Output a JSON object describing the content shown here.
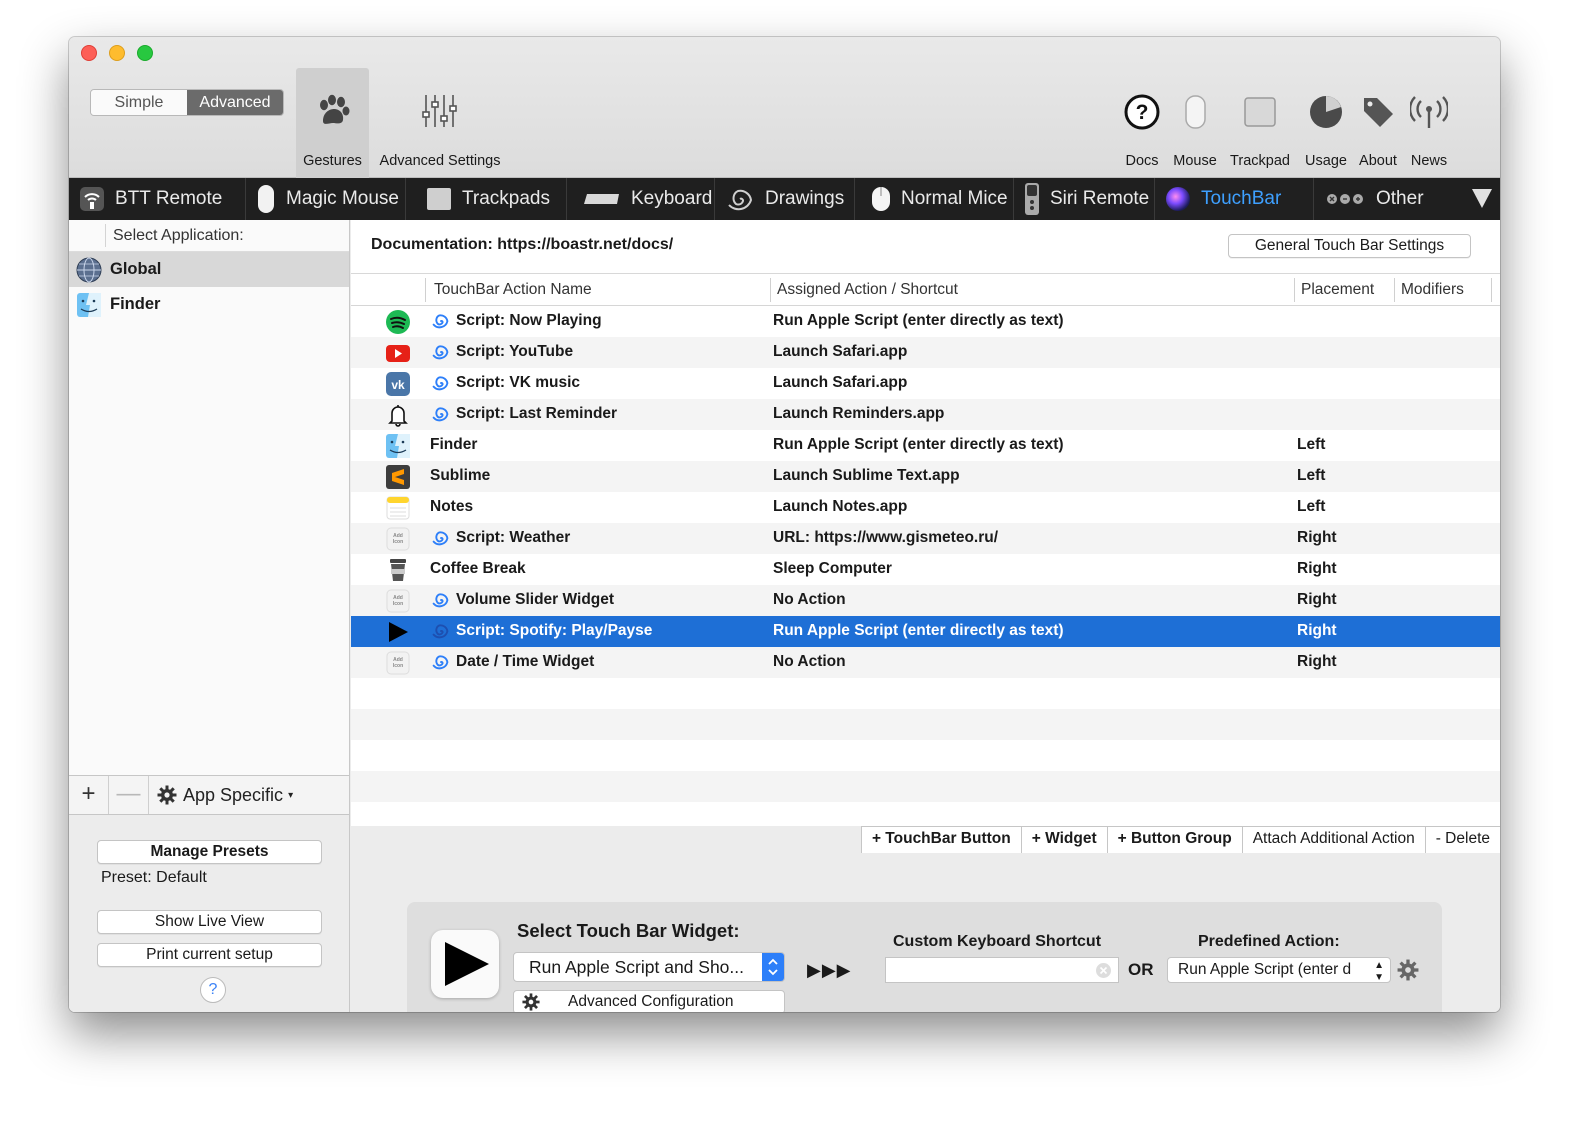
{
  "toolbar": {
    "mode_simple": "Simple",
    "mode_advanced": "Advanced",
    "gestures_label": "Gestures",
    "advanced_settings_label": "Advanced Settings",
    "right_tools": [
      "Docs",
      "Mouse",
      "Trackpad",
      "Usage",
      "About",
      "News"
    ]
  },
  "tabs": [
    "BTT Remote",
    "Magic Mouse",
    "Trackpads",
    "Keyboard",
    "Drawings",
    "Normal Mice",
    "Siri Remote",
    "TouchBar",
    "Other"
  ],
  "active_tab": "TouchBar",
  "sidebar": {
    "header": "Select Application:",
    "apps": [
      "Global",
      "Finder"
    ],
    "selected_app": "Global",
    "add": "+",
    "remove": "—",
    "app_specific": "App Specific",
    "manage_presets": "Manage Presets",
    "preset": "Preset: Default",
    "show_live_view": "Show Live View",
    "print_setup": "Print current setup",
    "help": "?"
  },
  "main": {
    "documentation": "Documentation: https://boastr.net/docs/",
    "general_settings": "General Touch Bar Settings",
    "columns": [
      "TouchBar Action Name",
      "Assigned Action / Shortcut",
      "Placement",
      "Modifiers"
    ],
    "rows": [
      {
        "icon": "spotify-icon",
        "script": true,
        "name": "Script: Now Playing",
        "action": "Run Apple Script (enter directly as text)",
        "placement": ""
      },
      {
        "icon": "youtube-icon",
        "script": true,
        "name": "Script: YouTube",
        "action": "Launch Safari.app",
        "placement": ""
      },
      {
        "icon": "vk-icon",
        "script": true,
        "name": "Script: VK music",
        "action": "Launch Safari.app",
        "placement": ""
      },
      {
        "icon": "bell-icon",
        "script": true,
        "name": "Script: Last Reminder",
        "action": "Launch Reminders.app",
        "placement": ""
      },
      {
        "icon": "finder-icon",
        "script": false,
        "name": "Finder",
        "action": "Run Apple Script (enter directly as text)",
        "placement": "Left"
      },
      {
        "icon": "sublime-icon",
        "script": false,
        "name": "Sublime",
        "action": "Launch Sublime Text.app",
        "placement": "Left"
      },
      {
        "icon": "notes-icon",
        "script": false,
        "name": "Notes",
        "action": "Launch Notes.app",
        "placement": "Left"
      },
      {
        "icon": "add-icon-placeholder",
        "script": true,
        "name": "Script: Weather",
        "action": "URL: https://www.gismeteo.ru/",
        "placement": "Right"
      },
      {
        "icon": "coffee-cup-icon",
        "script": false,
        "name": "Coffee Break",
        "action": "Sleep Computer",
        "placement": "Right"
      },
      {
        "icon": "add-icon-placeholder",
        "script": true,
        "name": "Volume Slider Widget",
        "action": "No Action",
        "placement": "Right"
      },
      {
        "icon": "play-icon",
        "script": true,
        "name": "Script: Spotify: Play/Payse",
        "action": "Run Apple Script (enter directly as text)",
        "placement": "Right",
        "selected": true
      },
      {
        "icon": "add-icon-placeholder",
        "script": true,
        "name": "Date / Time Widget",
        "action": "No Action",
        "placement": "Right"
      }
    ],
    "add_buttons": [
      "+ TouchBar Button",
      "+ Widget",
      "+ Button Group",
      "Attach Additional Action",
      "- Delete"
    ]
  },
  "widget": {
    "title": "Select Touch Bar Widget:",
    "selected_widget": "Run Apple Script and Sho...",
    "advanced_config": "Advanced Configuration",
    "arrows": "▶▶▶",
    "shortcut_label": "Custom Keyboard Shortcut",
    "or": "OR",
    "predefined_label": "Predefined Action:",
    "predefined_value": "Run Apple Script (enter d"
  },
  "colors": {
    "selection": "#1e6fd6",
    "active_tab": "#3ea0ff",
    "script_swirl": "#2d7ff9"
  }
}
